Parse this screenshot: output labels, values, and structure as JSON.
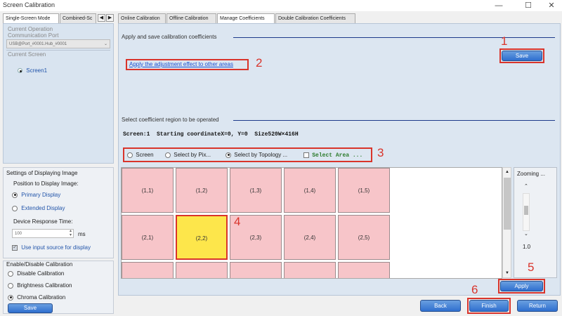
{
  "window": {
    "title": "Screen Calibration",
    "min_glyph": "—",
    "max_glyph": "☐",
    "close_glyph": "✕"
  },
  "left_tabs": {
    "single": "Single-Screen Mode",
    "combined": "Combined-Sc",
    "prev_glyph": "◀",
    "next_glyph": "▶"
  },
  "left_panel": {
    "current_op_label": "Current Operation",
    "comm_port_label": "Communication Port",
    "port_value": "USB@Port_#0001.Hub_#0001",
    "current_screen_label": "Current Screen",
    "screen_item": "Screen1"
  },
  "settings": {
    "title": "Settings of Displaying Image",
    "position_label": "Position to Display Image:",
    "primary_display": "Primary Display",
    "extended_display": "Extended Display",
    "response_label": "Device Response Time:",
    "response_value": "100",
    "response_unit": "ms",
    "use_input_source": "Use input source for display"
  },
  "enable": {
    "title": "Enable/Disable Calibration",
    "disable": "Disable Calibration",
    "brightness": "Brightness Calibration",
    "chroma": "Chroma Calibration",
    "save": "Save"
  },
  "main_tabs": [
    "Online Calibration",
    "Offline Calibration",
    "Manage Coefficients",
    "Double Calibration Coefficients"
  ],
  "manage": {
    "apply_save_title": "Apply and save calibration coefficients",
    "save": "Save",
    "apply_link": "Apply the adjustment effect to other areas",
    "select_region_title": "Select coefficient region to be operated",
    "info_line": "Screen:1  Starting coordinateX=0, Y=0  Size520W×416H",
    "options": {
      "screen": "Screen",
      "by_pixel": "Select by Pix...",
      "by_topology": "Select by Topology ...",
      "select_area": "Select Area ..."
    },
    "grid_cells": [
      [
        "(1,1)",
        "(1,2)",
        "(1,3)",
        "(1,4)",
        "(1,5)"
      ],
      [
        "(2,1)",
        "(2,2)",
        "(2,3)",
        "(2,4)",
        "(2,5)"
      ]
    ],
    "zoom_label": "Zooming ...",
    "zoom_value": "1.0",
    "apply": "Apply"
  },
  "footer": {
    "back": "Back",
    "finish": "Finish",
    "return": "Return"
  },
  "markers": [
    "1",
    "2",
    "3",
    "4",
    "5",
    "6"
  ],
  "colors": {
    "accent_blue": "#2f6fcf",
    "annotation_red": "#d9342b",
    "cell_pink": "#f7c5c9",
    "cell_selected": "#fde64b"
  }
}
